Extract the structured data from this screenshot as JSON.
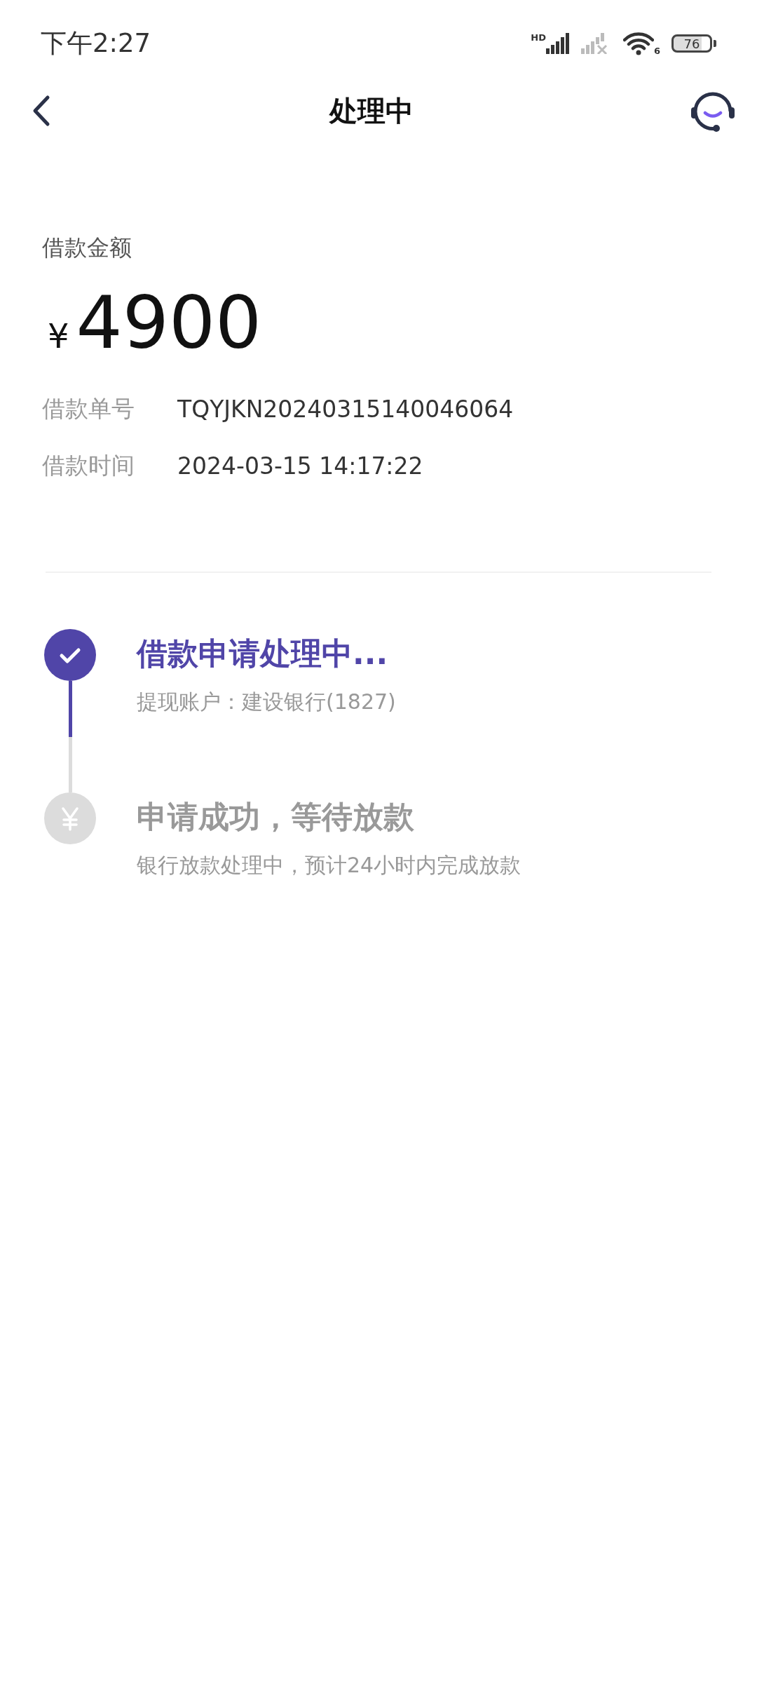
{
  "status_bar": {
    "time": "下午2:27",
    "network_badge": "HD",
    "wifi_badge": "6",
    "battery": "76"
  },
  "header": {
    "title": "处理中"
  },
  "loan": {
    "amount_label": "借款金额",
    "currency": "¥",
    "amount": "4900",
    "details": [
      {
        "label": "借款单号",
        "value": "TQYJKN20240315140046064"
      },
      {
        "label": "借款时间",
        "value": "2024-03-15 14:17:22"
      }
    ]
  },
  "steps": [
    {
      "title": "借款申请处理中...",
      "subtitle": "提现账户：建设银行(1827)",
      "completed": true
    },
    {
      "title": "申请成功，等待放款",
      "subtitle": "银行放款处理中，预计24小时内完成放款",
      "completed": false
    }
  ]
}
